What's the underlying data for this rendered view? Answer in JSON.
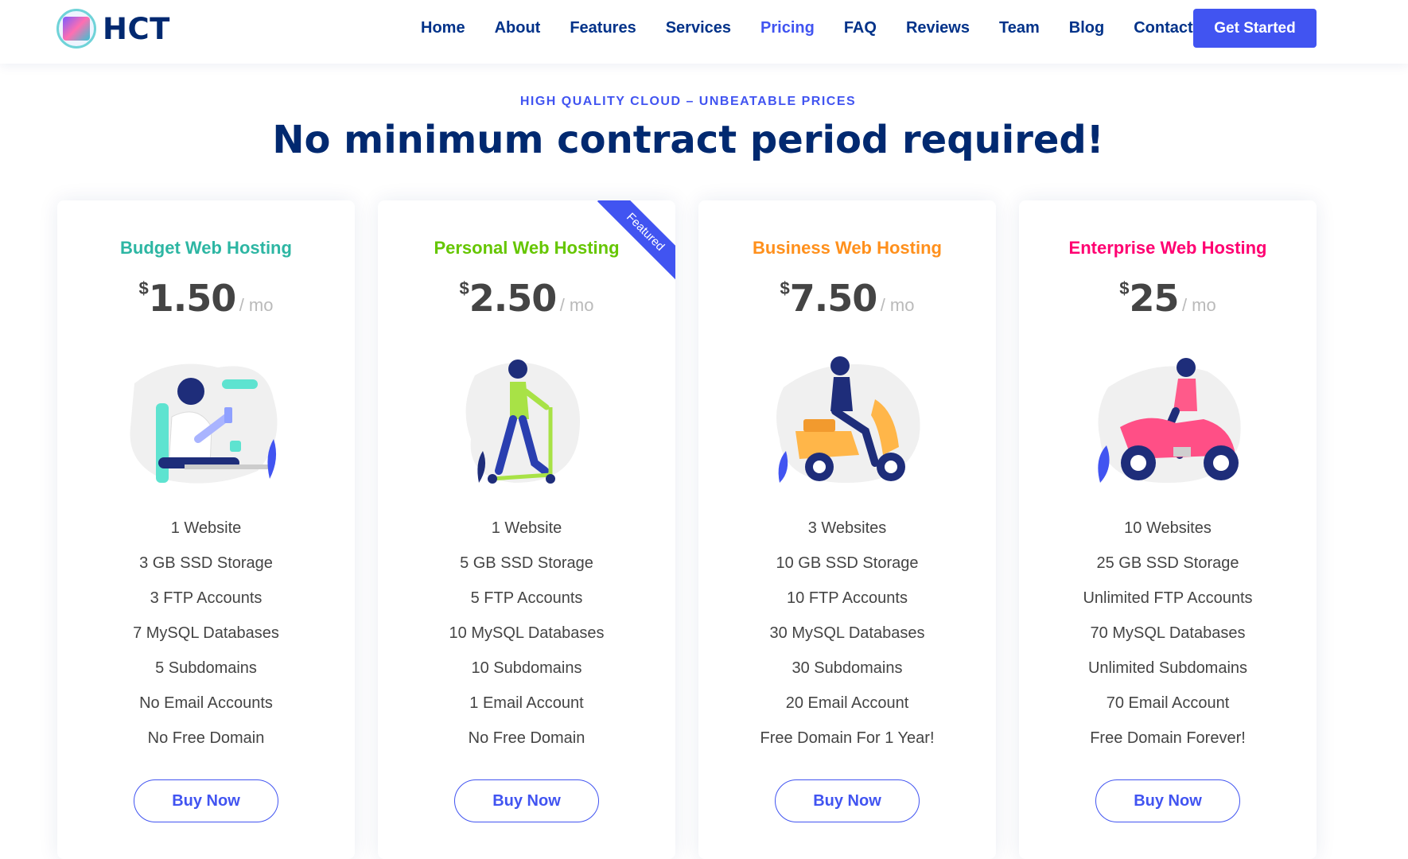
{
  "brand": {
    "name": "HCT"
  },
  "nav": {
    "items": [
      "Home",
      "About",
      "Features",
      "Services",
      "Pricing",
      "FAQ",
      "Reviews",
      "Team",
      "Blog",
      "Contact"
    ],
    "active": "Pricing",
    "cta": "Get Started"
  },
  "section": {
    "eyebrow": "HIGH QUALITY CLOUD – UNBEATABLE PRICES",
    "title": "No minimum contract period required!"
  },
  "plans": [
    {
      "name": "Budget Web Hosting",
      "color": "#2db6a3",
      "currency": "$",
      "price": "1.50",
      "period": "/ mo",
      "illustration": "person-with-phone-illustration",
      "features": [
        "1 Website",
        "3 GB SSD Storage",
        "3 FTP Accounts",
        "7 MySQL Databases",
        "5 Subdomains",
        "No Email Accounts",
        "No Free Domain"
      ],
      "button": "Buy Now"
    },
    {
      "name": "Personal Web Hosting",
      "color": "#65c600",
      "currency": "$",
      "price": "2.50",
      "period": "/ mo",
      "illustration": "person-on-scooter-illustration",
      "ribbon": "Featured",
      "features": [
        "1 Website",
        "5 GB SSD Storage",
        "5 FTP Accounts",
        "10 MySQL Databases",
        "10 Subdomains",
        "1 Email Account",
        "No Free Domain"
      ],
      "button": "Buy Now"
    },
    {
      "name": "Business Web Hosting",
      "color": "#ff901c",
      "currency": "$",
      "price": "7.50",
      "period": "/ mo",
      "illustration": "person-on-moped-illustration",
      "features": [
        "3 Websites",
        "10 GB SSD Storage",
        "10 FTP Accounts",
        "30 MySQL Databases",
        "30 Subdomains",
        "20 Email Account",
        "Free Domain For 1 Year!"
      ],
      "button": "Buy Now"
    },
    {
      "name": "Enterprise Web Hosting",
      "color": "#ff0071",
      "currency": "$",
      "price": "25",
      "period": "/ mo",
      "illustration": "person-on-motorcycle-illustration",
      "features": [
        "10 Websites",
        "25 GB SSD Storage",
        "Unlimited FTP Accounts",
        "70 MySQL Databases",
        "Unlimited Subdomains",
        "70 Email Account",
        "Free Domain Forever!"
      ],
      "button": "Buy Now"
    }
  ],
  "colors": {
    "accent": "#4154f1",
    "navy": "#012970"
  }
}
